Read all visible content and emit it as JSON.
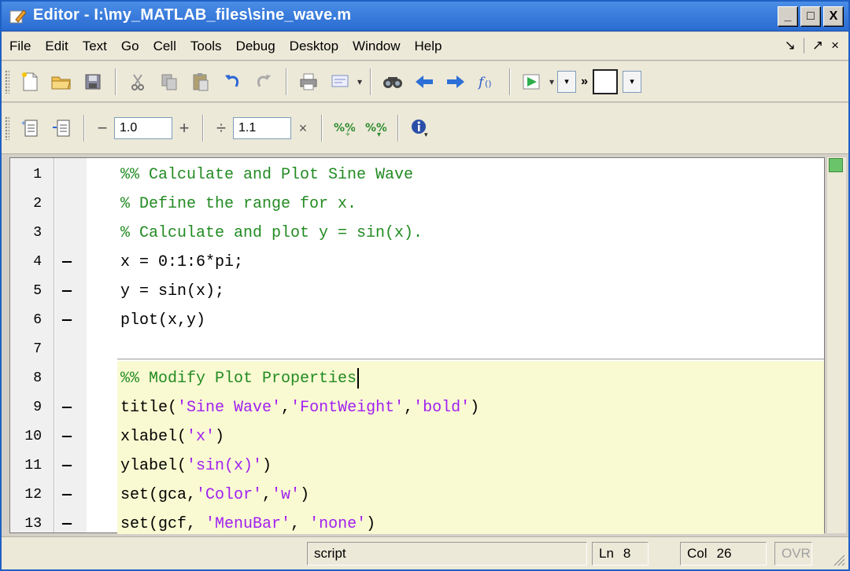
{
  "window": {
    "title": "Editor - I:\\my_MATLAB_files\\sine_wave.m",
    "minimize": "_",
    "maximize": "□",
    "close": "X"
  },
  "menu": {
    "items": [
      "File",
      "Edit",
      "Text",
      "Go",
      "Cell",
      "Tools",
      "Debug",
      "Desktop",
      "Window",
      "Help"
    ],
    "right_dock": "↘",
    "right_undock": "↗",
    "right_close": "×"
  },
  "toolbar": {
    "icons": [
      "new-file-icon",
      "open-folder-icon",
      "save-icon",
      "cut-icon",
      "copy-icon",
      "paste-icon",
      "undo-icon",
      "redo-icon",
      "print-icon",
      "comment-icon",
      "find-icon",
      "back-icon",
      "forward-icon",
      "function-icon",
      "run-icon"
    ],
    "chevron": "»"
  },
  "cell_toolbar": {
    "decrement_symbol": "−",
    "increment_symbol": "+",
    "value_1": "1.0",
    "divide_symbol": "÷",
    "value_2": "1.1",
    "multiply_symbol": "×"
  },
  "editor": {
    "lines": [
      {
        "num": "1",
        "marker": "",
        "segments": [
          {
            "t": "%% Calculate and Plot Sine Wave",
            "k": "comment"
          }
        ]
      },
      {
        "num": "2",
        "marker": "",
        "segments": [
          {
            "t": "% Define the range for x.",
            "k": "comment"
          }
        ]
      },
      {
        "num": "3",
        "marker": "",
        "segments": [
          {
            "t": "% Calculate and plot y = sin(x).",
            "k": "comment"
          }
        ]
      },
      {
        "num": "4",
        "marker": "—",
        "segments": [
          {
            "t": "x = 0:1:6*pi;",
            "k": "plain"
          }
        ]
      },
      {
        "num": "5",
        "marker": "—",
        "segments": [
          {
            "t": "y = sin(x);",
            "k": "plain"
          }
        ]
      },
      {
        "num": "6",
        "marker": "—",
        "segments": [
          {
            "t": "plot(x,y)",
            "k": "plain"
          }
        ]
      },
      {
        "num": "7",
        "marker": "",
        "segments": []
      },
      {
        "num": "8",
        "marker": "",
        "segments": [
          {
            "t": "%% Modify Plot Properties",
            "k": "comment"
          }
        ],
        "caret": true
      },
      {
        "num": "9",
        "marker": "—",
        "segments": [
          {
            "t": "title(",
            "k": "plain"
          },
          {
            "t": "'Sine Wave'",
            "k": "string"
          },
          {
            "t": ",",
            "k": "plain"
          },
          {
            "t": "'FontWeight'",
            "k": "string"
          },
          {
            "t": ",",
            "k": "plain"
          },
          {
            "t": "'bold'",
            "k": "string"
          },
          {
            "t": ")",
            "k": "plain"
          }
        ]
      },
      {
        "num": "10",
        "marker": "—",
        "segments": [
          {
            "t": "xlabel(",
            "k": "plain"
          },
          {
            "t": "'x'",
            "k": "string"
          },
          {
            "t": ")",
            "k": "plain"
          }
        ]
      },
      {
        "num": "11",
        "marker": "—",
        "segments": [
          {
            "t": "ylabel(",
            "k": "plain"
          },
          {
            "t": "'sin(x)'",
            "k": "string"
          },
          {
            "t": ")",
            "k": "plain"
          }
        ]
      },
      {
        "num": "12",
        "marker": "—",
        "segments": [
          {
            "t": "set(gca,",
            "k": "plain"
          },
          {
            "t": "'Color'",
            "k": "string"
          },
          {
            "t": ",",
            "k": "plain"
          },
          {
            "t": "'w'",
            "k": "string"
          },
          {
            "t": ")",
            "k": "plain"
          }
        ]
      },
      {
        "num": "13",
        "marker": "—",
        "segments": [
          {
            "t": "set(gcf, ",
            "k": "plain"
          },
          {
            "t": "'MenuBar'",
            "k": "string"
          },
          {
            "t": ", ",
            "k": "plain"
          },
          {
            "t": "'none'",
            "k": "string"
          },
          {
            "t": ")",
            "k": "plain"
          }
        ]
      }
    ]
  },
  "status": {
    "mode": "script",
    "ln_label": "Ln",
    "ln_value": "8",
    "col_label": "Col",
    "col_value": "26",
    "ovr": "OVR"
  },
  "colors": {
    "comment": "#228b22",
    "string": "#a020f0",
    "cell_highlight": "#fafad2",
    "titlebar": "#2a6bd1"
  }
}
